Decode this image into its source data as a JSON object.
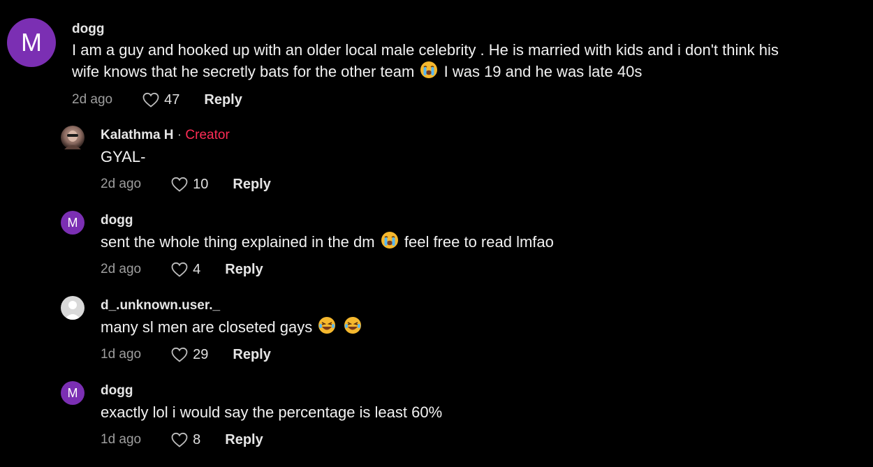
{
  "comments": [
    {
      "avatar_letter": "M",
      "username": "dogg",
      "text_part1": "I am a guy and hooked up with an older local male celebrity . He is married with kids and i don't think his",
      "text_part2a": "wife knows that he secretly bats for the other team",
      "text_part2b": "I was 19 and he was late 40s",
      "time": "2d ago",
      "likes": "47",
      "reply": "Reply"
    },
    {
      "username": "Kalathma H",
      "separator": " · ",
      "badge": "Creator",
      "text": "GYAL-",
      "time": "2d ago",
      "likes": "10",
      "reply": "Reply"
    },
    {
      "avatar_letter": "M",
      "username": "dogg",
      "text_a": "sent the whole thing explained in the dm",
      "text_b": "feel free to read lmfao",
      "time": "2d ago",
      "likes": "4",
      "reply": "Reply"
    },
    {
      "username": "d_.unknown.user._",
      "text": "many sl men are closeted gays",
      "time": "1d ago",
      "likes": "29",
      "reply": "Reply"
    },
    {
      "avatar_letter": "M",
      "username": "dogg",
      "text": "exactly lol i would say the percentage is least 60%",
      "time": "1d ago",
      "likes": "8",
      "reply": "Reply"
    }
  ],
  "icons": {
    "like": "heart-outline-icon",
    "emoji_cry": "loudly-crying-face-emoji",
    "emoji_laugh": "laughing-face-emoji"
  },
  "colors": {
    "background": "#000000",
    "avatar_purple": "#7b2fb3",
    "creator_badge": "#fe2c55"
  }
}
